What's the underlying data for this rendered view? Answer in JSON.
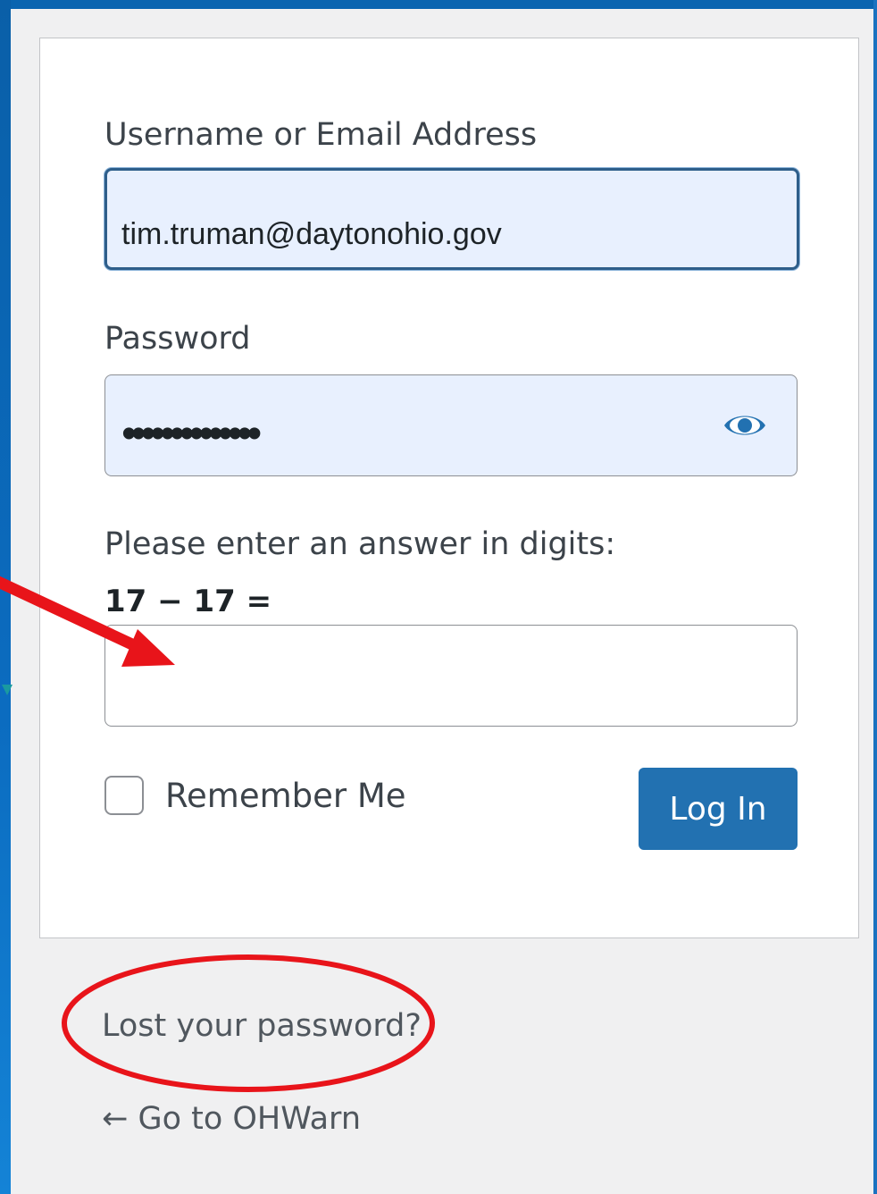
{
  "form": {
    "username_label": "Username or Email Address",
    "username_value": "tim.truman@daytonohio.gov",
    "password_label": "Password",
    "password_masked": "••••••••••••••",
    "captcha_label": "Please enter an answer in digits:",
    "captcha_question": "17 − 17 =",
    "captcha_value": "",
    "remember_label": "Remember Me",
    "remember_checked": false,
    "login_button": "Log In"
  },
  "links": {
    "lost_password": "Lost your password?",
    "back_to_site": "← Go to OHWarn"
  },
  "icons": {
    "password_toggle": "eye-icon"
  },
  "annotation_colors": {
    "arrow": "#e8141a",
    "circle": "#e8141a"
  },
  "colors": {
    "primary_button": "#2271b1",
    "autofill_bg": "#e8f0fe",
    "page_bg": "#f0f0f1"
  }
}
